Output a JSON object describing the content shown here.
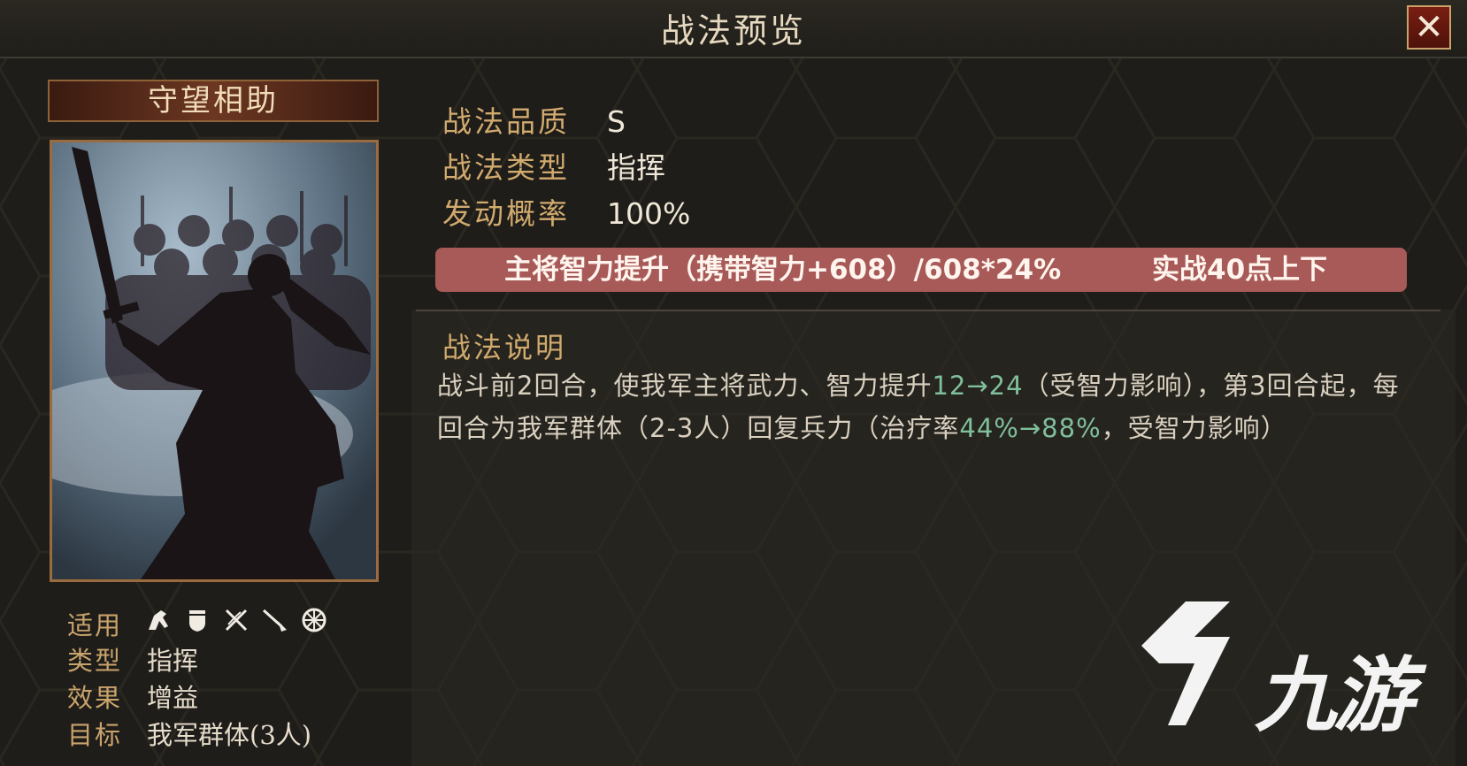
{
  "window": {
    "title": "战法预览",
    "close_label": "✕"
  },
  "skill": {
    "name": "守望相助",
    "applicable_label": "适用",
    "applicable_units": [
      "cavalry-icon",
      "shield-icon",
      "bow-icon",
      "spear-icon",
      "machine-icon"
    ],
    "meta": [
      {
        "label": "类型",
        "value": "指挥"
      },
      {
        "label": "效果",
        "value": "增益"
      },
      {
        "label": "目标",
        "value": "我军群体(3人)"
      }
    ]
  },
  "info": [
    {
      "label": "战法品质",
      "value": "S"
    },
    {
      "label": "战法类型",
      "value": "指挥"
    },
    {
      "label": "发动概率",
      "value": "100%"
    }
  ],
  "banner": {
    "part1": "主将智力提升（携带智力+608）/608*24%",
    "part2": "实战40点上下"
  },
  "description": {
    "title": "战法说明",
    "segments": [
      "战斗前",
      "2",
      "回合，使我军主将武力、智力提升",
      "12→24",
      "（受智力影响），第",
      "3",
      "回合起，每回合为我军群体（",
      "2-3",
      "人）回复兵力（治疗率",
      "44%→88%",
      "，受智力影响）"
    ]
  },
  "watermark": {
    "text": "九游"
  },
  "colors": {
    "accent_gold": "#d1aa6e",
    "banner_red": "#a85a58",
    "highlight_green": "#7fbf9c",
    "close_red": "#6b1a10"
  }
}
